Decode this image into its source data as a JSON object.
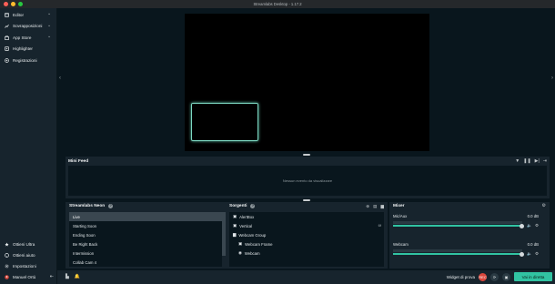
{
  "window": {
    "title": "Streamlabs Desktop - 1.17.2",
    "traffic_colors": [
      "#fe5f57",
      "#febc2e",
      "#28c840"
    ]
  },
  "sidebar": {
    "top_items": [
      {
        "label": "Editor",
        "icon": "editor-icon",
        "has_chevron": true
      },
      {
        "label": "Sovrapposizioni",
        "icon": "overlay-icon",
        "has_chevron": true
      },
      {
        "label": "App Store",
        "icon": "store-icon",
        "has_chevron": true
      },
      {
        "label": "Highlighter",
        "icon": "highlighter-icon",
        "has_chevron": false
      },
      {
        "label": "Registrazioni",
        "icon": "recordings-icon",
        "has_chevron": false
      }
    ],
    "bottom_items": [
      {
        "label": "Ottieni Ultra",
        "icon": "ultra-icon"
      },
      {
        "label": "Ottieni aiuto",
        "icon": "help-icon"
      },
      {
        "label": "Impostazioni",
        "icon": "gear-icon"
      },
      {
        "label": "Manuel Ortù",
        "icon": "avatar-icon"
      }
    ]
  },
  "mini_feed": {
    "title": "Mini Feed",
    "empty_text": "Nessun evento da visualizzare"
  },
  "scenes": {
    "title": "Streamlabs Neon",
    "items": [
      "Live",
      "Starting Soon",
      "Ending Soon",
      "Be Right Back",
      "Intermission",
      "Collab Cam 4"
    ],
    "selected": "Live"
  },
  "sources": {
    "title": "Sorgenti",
    "items": [
      {
        "label": "AlertBox",
        "icon": "alertbox-icon",
        "indent": false,
        "extra": ""
      },
      {
        "label": "Vertical",
        "icon": "vertical-icon",
        "indent": false,
        "extra": "6f"
      },
      {
        "label": "Webcam Group",
        "icon": "folder-icon",
        "indent": false,
        "extra": ""
      },
      {
        "label": "Webcam Frame",
        "icon": "frame-icon",
        "indent": true,
        "extra": ""
      },
      {
        "label": "Webcam",
        "icon": "webcam-icon",
        "indent": true,
        "extra": ""
      }
    ]
  },
  "mixer": {
    "title": "Mixer",
    "tracks": [
      {
        "name": "Mic/Aux",
        "db": "0.0 dB",
        "level": 1.0
      },
      {
        "name": "Webcam",
        "db": "0.0 dB",
        "level": 1.0
      }
    ]
  },
  "footer": {
    "test_widgets_label": "Widget di prova",
    "go_live_label": "Vai in diretta",
    "accent_color": "#31c3a2",
    "rec_color": "#d9463b"
  }
}
